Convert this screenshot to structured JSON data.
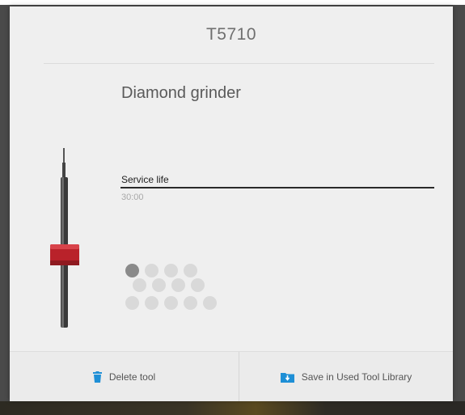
{
  "dialog": {
    "title": "T5710",
    "tool_name": "Diamond grinder",
    "service_life": {
      "label": "Service life",
      "value": "30:00"
    },
    "usage_dots": {
      "rows": [
        4,
        4,
        5
      ],
      "active_count": 1
    },
    "icons": {
      "tool": "grinder-tool-icon",
      "delete": "trash-icon",
      "save": "folder-download-icon"
    },
    "colors": {
      "accent": "#1e8fd6",
      "tool_band": "#c8262d"
    }
  },
  "footer": {
    "delete_label": "Delete tool",
    "save_label": "Save in Used Tool Library"
  }
}
